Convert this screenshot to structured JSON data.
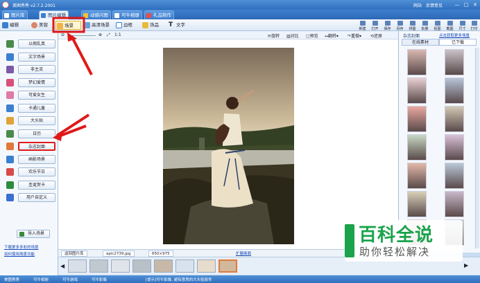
{
  "window": {
    "title": "美图秀秀  v2.7.2.2001",
    "links": [
      "网站",
      "反馈意见"
    ],
    "controls": {
      "minimize": "—",
      "maximize": "□",
      "close": "✕"
    }
  },
  "tabs": [
    {
      "label": "图片库",
      "icon": "picture-library-icon"
    },
    {
      "label": "图片编辑",
      "icon": "edit-icon",
      "active": true
    },
    {
      "label": "动感闪图",
      "icon": "flash-icon"
    },
    {
      "label": "可牛相册",
      "icon": "album-icon"
    },
    {
      "label": "礼品制作",
      "icon": "gift-icon"
    }
  ],
  "toolbar": {
    "items": [
      {
        "label": "编辑",
        "icon": "edit-icon"
      },
      {
        "label": "美容",
        "icon": "beauty-icon"
      },
      {
        "label": "场景",
        "icon": "scene-icon",
        "active": true
      },
      {
        "label": "高清场景",
        "icon": "hd-scene-icon"
      },
      {
        "label": "边框",
        "icon": "frame-icon"
      },
      {
        "label": "饰品",
        "icon": "accessory-icon"
      },
      {
        "label": "文字",
        "icon": "text-icon"
      }
    ],
    "right": [
      "新建",
      "打开",
      "保存",
      "另存",
      "拼图",
      "批量",
      "抠图",
      "截图",
      "尺寸",
      "打印"
    ]
  },
  "canvas_toolbar": {
    "zoom": "1:1",
    "items": [
      "旋转",
      "对比",
      "预览",
      "翻转",
      "重做",
      "还原"
    ]
  },
  "left_panel": {
    "categories": [
      {
        "label": "以假乱真",
        "icon": "scene-icon"
      },
      {
        "label": "文字场景",
        "icon": "text-scene-icon"
      },
      {
        "label": "非主流",
        "icon": "alt-style-icon"
      },
      {
        "label": "梦幻爱情",
        "icon": "heart-icon"
      },
      {
        "label": "可爱女生",
        "icon": "girl-icon"
      },
      {
        "label": "卡通儿童",
        "icon": "cartoon-icon"
      },
      {
        "label": "大头贴",
        "icon": "sticker-icon"
      },
      {
        "label": "日历",
        "icon": "calendar-icon"
      },
      {
        "label": "杂志封面",
        "icon": "magazine-icon",
        "highlighted": true
      },
      {
        "label": "画影场景",
        "icon": "frame-scene-icon"
      },
      {
        "label": "欢乐节日",
        "icon": "festival-icon"
      },
      {
        "label": "圣诞贺卡",
        "icon": "christmas-tree-icon"
      },
      {
        "label": "用户自定义",
        "icon": "star-icon"
      }
    ],
    "import_button": "导入场景",
    "links": [
      "下载更多多彩的场景",
      "如何使用场景功能"
    ]
  },
  "right_panel": {
    "title": "杂志封面",
    "link": "点击获取更多场景",
    "tabs": [
      "在线素材",
      "已下载"
    ],
    "active_tab": 1,
    "thumbnail_count": 14
  },
  "info_bar": [
    "返回图片库",
    "apic2739.jpg",
    "650×975",
    "扩展画面"
  ],
  "filmstrip_count": 8,
  "status_bar": [
    "美图秀秀",
    "可牛相册",
    "可牛游戏",
    "可牛影像",
    "[提示]可牛影像, 超有意思的大头贴软件"
  ],
  "watermark": {
    "main": "百科全说",
    "sub": "助你轻松解决"
  },
  "colors": {
    "accent": "#2f6fbf",
    "highlight": "#e01818",
    "watermark": "#1aa34a"
  }
}
